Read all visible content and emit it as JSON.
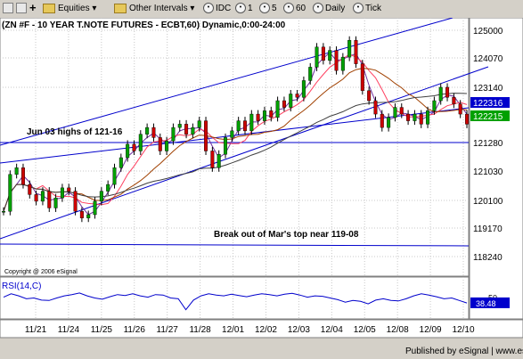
{
  "toolbar": {
    "symbol_field": "",
    "equities_label": "Equities",
    "other_intervals_label": "Other Intervals",
    "intervals": [
      "IDC",
      "1",
      "5",
      "60",
      "Daily",
      "Tick"
    ]
  },
  "chart_data": {
    "type": "line",
    "title": "(ZN #F - 10 YEAR T.NOTE FUTURES - ECBT,60) Dynamic,0:00-24:00",
    "copyright": "Copyright @ 2006 eSignal",
    "footer": "Published by eSignal | www.esignal.com",
    "y_ticks": [
      "125000",
      "124070",
      "123140",
      "122316",
      "122215",
      "121280",
      "121030",
      "120100",
      "119170",
      "118240"
    ],
    "current_price_labels": [
      "122316",
      "122215"
    ],
    "x_ticks": [
      "11/21",
      "11/24",
      "11/25",
      "11/26",
      "11/27",
      "11/28",
      "12/01",
      "12/02",
      "12/03",
      "12/04",
      "12/05",
      "12/08",
      "12/09",
      "12/10"
    ],
    "annotations": [
      "Jun 03 highs of 121-16",
      "Break out of Mar's top near 119-08"
    ],
    "price_path": [
      119.6,
      120.7,
      120.9,
      120.4,
      120.1,
      119.9,
      120.2,
      119.7,
      120.0,
      120.3,
      120.2,
      119.6,
      119.4,
      119.5,
      119.9,
      120.2,
      120.4,
      120.9,
      121.2,
      121.6,
      121.4,
      121.9,
      122.1,
      121.8,
      121.4,
      121.7,
      122.1,
      122.2,
      121.9,
      122.1,
      122.3,
      121.4,
      120.9,
      121.3,
      121.8,
      122.0,
      122.3,
      122.0,
      122.5,
      122.3,
      122.6,
      122.4,
      122.9,
      122.7,
      123.1,
      123.0,
      123.5,
      123.9,
      124.5,
      124.1,
      124.4,
      123.8,
      124.2,
      124.7,
      124.0,
      123.2,
      122.9,
      122.5,
      122.1,
      122.4,
      122.7,
      122.5,
      122.3,
      122.5,
      122.2,
      122.6,
      122.9,
      123.3,
      123.0,
      122.8,
      122.5,
      122.2
    ],
    "indicator": {
      "name": "RSI(14,C)",
      "levels": [
        "50",
        "38.48"
      ],
      "values": [
        52,
        60,
        55,
        48,
        50,
        45,
        44,
        50,
        55,
        58,
        62,
        55,
        50,
        47,
        53,
        58,
        56,
        60,
        55,
        52,
        58,
        57,
        50,
        48,
        22,
        45,
        55,
        60,
        57,
        55,
        59,
        56,
        53,
        57,
        60,
        58,
        55,
        59,
        61,
        57,
        52,
        55,
        54,
        50,
        46,
        40,
        44,
        42,
        36,
        45,
        48,
        44,
        43,
        48,
        55,
        60,
        57,
        53,
        48,
        50,
        44,
        38
      ]
    },
    "colors": {
      "price": "#000000",
      "channel": "#0000cc",
      "ma_fast": "#7030a0",
      "ma_mid": "#ff4060",
      "ma_slow": "#a04000",
      "ma_long": "#404040",
      "rsi": "#0000cc"
    }
  }
}
